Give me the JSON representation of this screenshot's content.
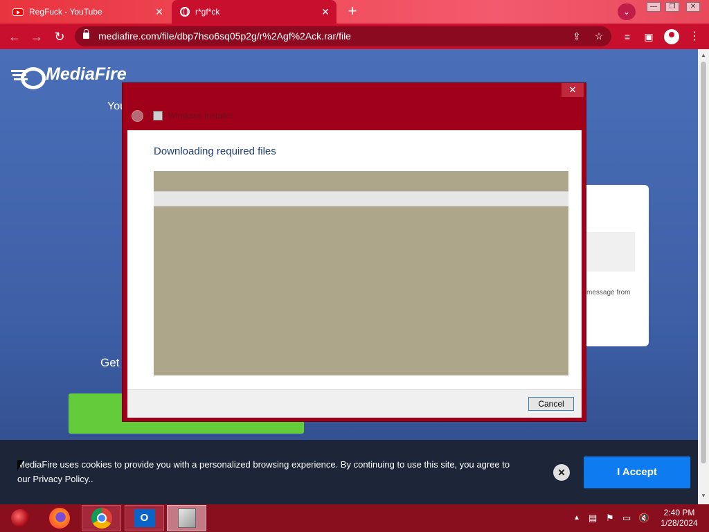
{
  "browser": {
    "tabs": [
      {
        "title": "RegFuck - YouTube",
        "icon": "youtube-icon",
        "active": false
      },
      {
        "title": "r*gf*ck",
        "icon": "globe-icon",
        "active": true
      }
    ],
    "address": "mediafire.com/file/dbp7hso6sq05p2g/r%2Agf%2Ack.rar/file"
  },
  "page": {
    "logo_text": "MediaFire",
    "you_fragment": "You",
    "get_fragment": "Get",
    "right_card_fragment": "message from"
  },
  "dialog": {
    "title": "Windows Installer",
    "heading": "Downloading required files",
    "cancel_label": "Cancel",
    "close_label": "✕",
    "progress": 0
  },
  "cookie": {
    "text": "MediaFire uses cookies to provide you with a personalized browsing experience. By continuing to use this site, you agree to our Privacy Policy..",
    "accept_label": "I Accept"
  },
  "taskbar": {
    "apps": [
      "start-orb",
      "firefox",
      "chrome",
      "outlook",
      "installer"
    ],
    "time": "2:40 PM",
    "date": "1/28/2024"
  },
  "colors": {
    "chrome_red": "#c8102e",
    "dialog_frame": "#a1001a",
    "accept_blue": "#0e7cf0",
    "green_button": "#63cc3a"
  }
}
